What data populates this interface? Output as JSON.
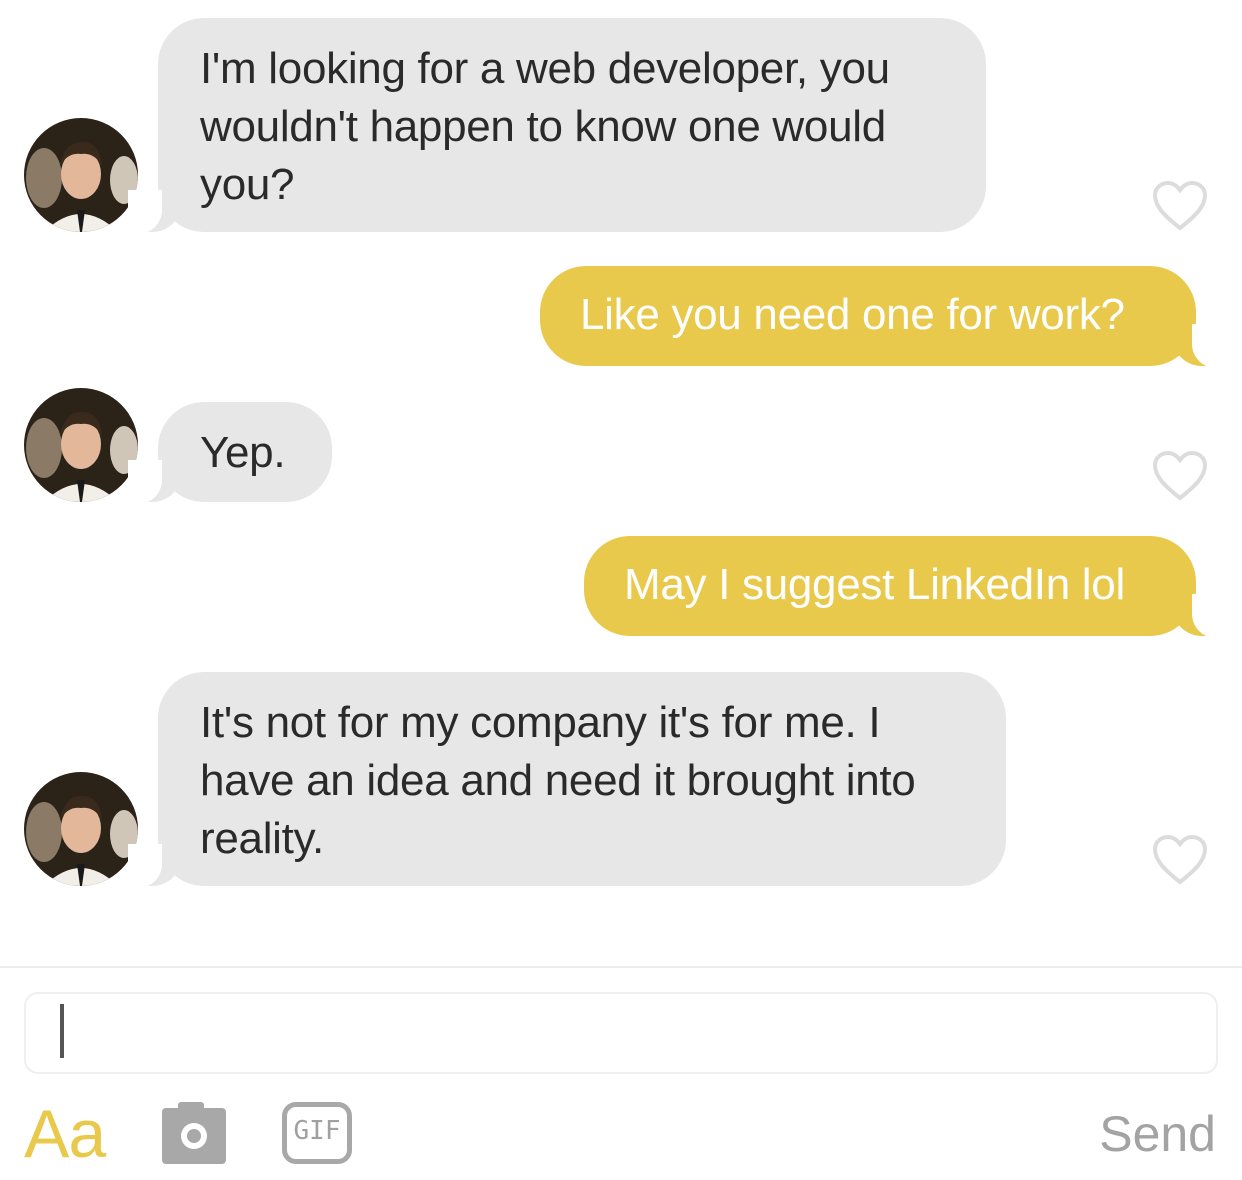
{
  "messages": [
    {
      "sender": "them",
      "text": "I'm looking for a web developer, you\nwouldn't happen to know one would\nyou?"
    },
    {
      "sender": "me",
      "text": "Like you need one for work?"
    },
    {
      "sender": "them",
      "text": "Yep."
    },
    {
      "sender": "me",
      "text": "May I suggest LinkedIn lol"
    },
    {
      "sender": "them",
      "text": "It's not for my company it's for me. I\nhave an idea and need it brought into\nreality."
    }
  ],
  "composer": {
    "input_value": "",
    "font_toggle_label": "Aa",
    "gif_label": "GIF",
    "send_label": "Send"
  },
  "colors": {
    "incoming_bubble": "#e7e7e7",
    "outgoing_bubble": "#e9c94b",
    "accent": "#e9c94b",
    "muted": "#a3a3a3"
  },
  "icons": {
    "avatar": "avatar",
    "like": "heart-icon",
    "camera": "camera-icon",
    "gif": "gif-icon"
  }
}
